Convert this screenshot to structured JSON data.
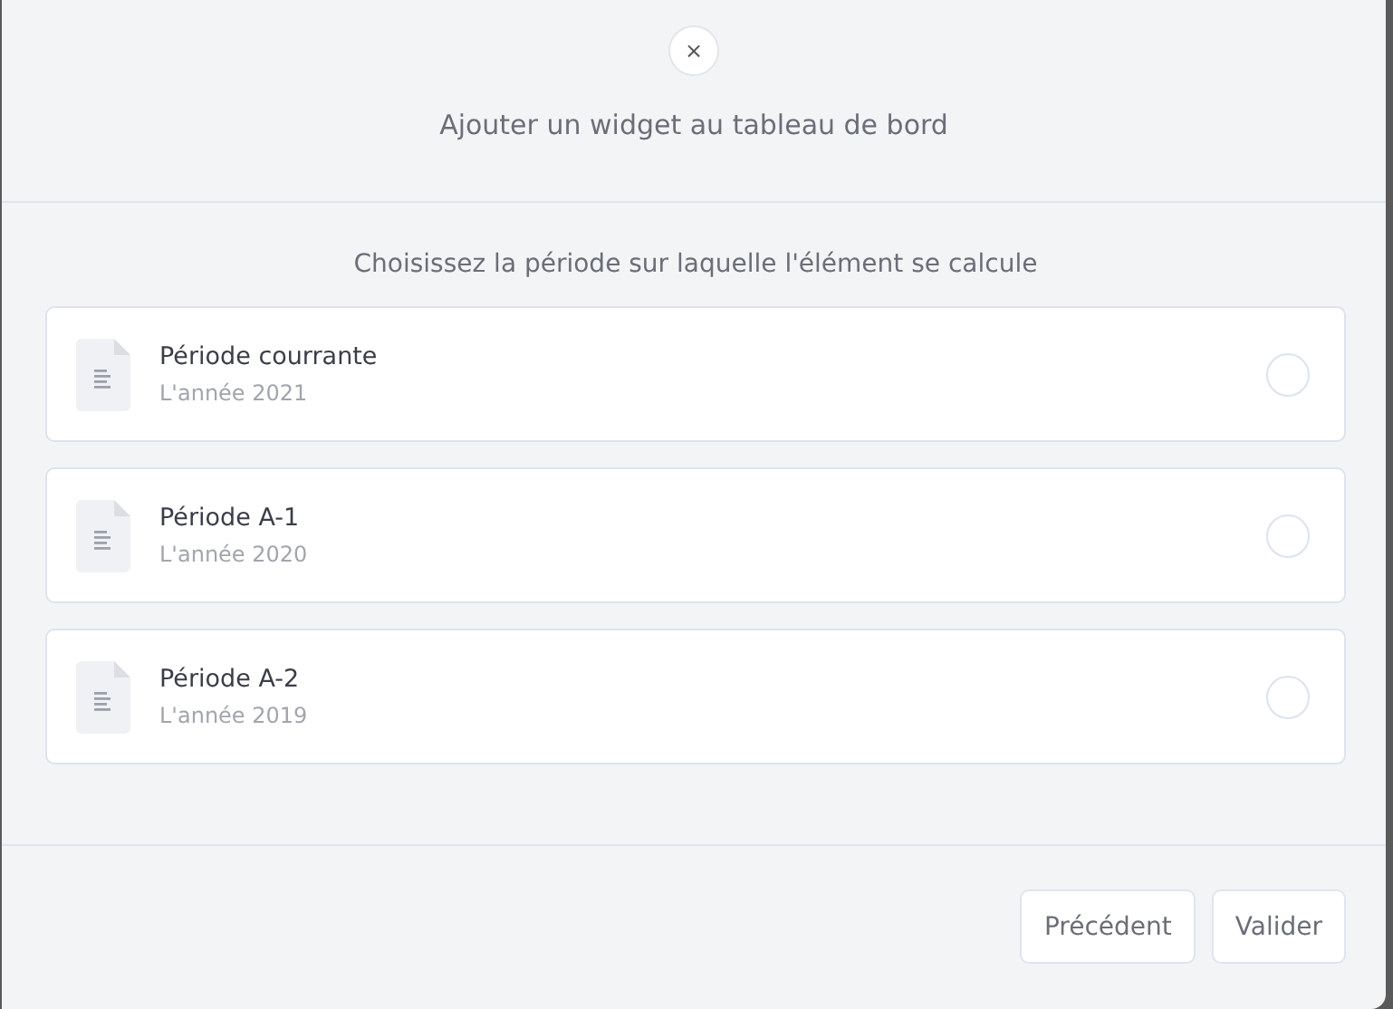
{
  "dialog": {
    "close": "×",
    "title": "Ajouter un widget au tableau de bord"
  },
  "prompt": "Choisissez la période sur laquelle l'élément se calcule",
  "options": [
    {
      "title": "Période courrante",
      "subtitle": "L'année 2021",
      "selected": false
    },
    {
      "title": "Période A-1",
      "subtitle": "L'année 2020",
      "selected": false
    },
    {
      "title": "Période A-2",
      "subtitle": "L'année 2019",
      "selected": false
    }
  ],
  "buttons": [
    "Précédent",
    "Valider"
  ]
}
